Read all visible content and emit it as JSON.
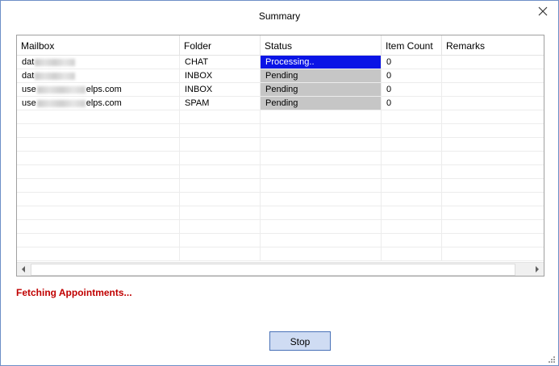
{
  "window": {
    "title": "Summary",
    "close_icon": "close-icon"
  },
  "grid": {
    "columns": [
      "Mailbox",
      "Folder",
      "Status",
      "Item Count",
      "Remarks"
    ],
    "rows": [
      {
        "mailbox_prefix": "dat",
        "mailbox_suffix": "",
        "folder": "CHAT",
        "status": "Processing..",
        "status_kind": "processing",
        "item_count": "0",
        "remarks": ""
      },
      {
        "mailbox_prefix": "dat",
        "mailbox_suffix": "",
        "folder": "INBOX",
        "status": "Pending",
        "status_kind": "pending",
        "item_count": "0",
        "remarks": ""
      },
      {
        "mailbox_prefix": "use",
        "mailbox_suffix": "elps.com",
        "folder": "INBOX",
        "status": "Pending",
        "status_kind": "pending",
        "item_count": "0",
        "remarks": ""
      },
      {
        "mailbox_prefix": "use",
        "mailbox_suffix": "elps.com",
        "folder": "SPAM",
        "status": "Pending",
        "status_kind": "pending",
        "item_count": "0",
        "remarks": ""
      }
    ],
    "colors": {
      "processing": "#0a14e6",
      "pending": "#c6c6c6"
    }
  },
  "status_message": "Fetching Appointments...",
  "stop_button": {
    "label": "Stop"
  }
}
